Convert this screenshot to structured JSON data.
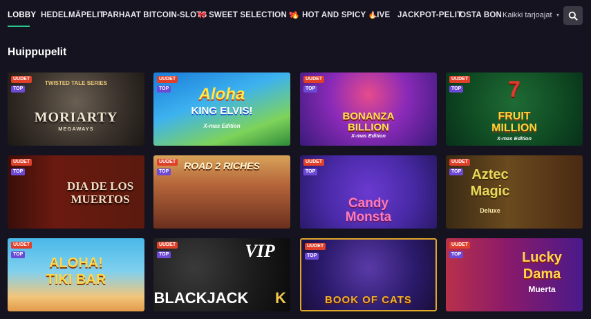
{
  "nav": {
    "items": [
      {
        "label": "LOBBY",
        "active": true
      },
      {
        "label": "HEDELMÄPELIT"
      },
      {
        "label": "PARHAAT BITCOIN-SLOTS"
      },
      {
        "label": "SWEET SELECTION",
        "icon": "bow-icon"
      },
      {
        "label": "HOT AND SPICY",
        "icon": "fire-icon"
      },
      {
        "label": "LIVE"
      },
      {
        "label": "JACKPOT-PELIT"
      },
      {
        "label": "OSTA BON"
      }
    ],
    "provider_filter": "Kaikki tarjoajat",
    "accent": "#27c88c"
  },
  "section": {
    "title": "Huippupelit"
  },
  "badges": {
    "new": "UUDET",
    "top": "TOP"
  },
  "games": [
    {
      "title": "MORIARTY",
      "subtitle": "MEGAWAYS",
      "logo": "TWISTED TALE SERIES"
    },
    {
      "title": "Aloha",
      "subtitle": "KING ELVIS!",
      "extra": "X-mas Edition"
    },
    {
      "title": "BONANZA",
      "subtitle": "BILLION",
      "extra": "X-mas Edition"
    },
    {
      "title": "FRUIT",
      "subtitle": "MILLION",
      "extra": "X-mas Edition"
    },
    {
      "title": "DIA DE LOS",
      "subtitle": "MUERTOS"
    },
    {
      "title": "ROAD 2 RICHES",
      "subtitle": ""
    },
    {
      "title": "Candy",
      "subtitle": "Monsta"
    },
    {
      "title": "Aztec",
      "subtitle": "Magic",
      "extra": "Deluxe"
    },
    {
      "title": "ALOHA!",
      "subtitle": "TIKI BAR"
    },
    {
      "title": "BLACKJACK",
      "subtitle": "K",
      "extra": "VIP"
    },
    {
      "title": "BOOK OF CATS",
      "subtitle": ""
    },
    {
      "title": "Lucky",
      "subtitle": "Dama",
      "extra": "Muerta"
    }
  ]
}
